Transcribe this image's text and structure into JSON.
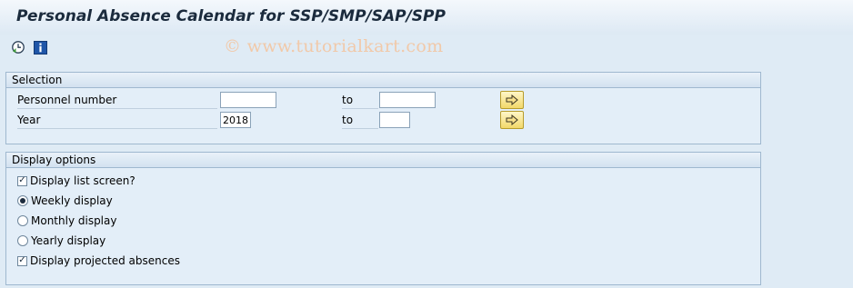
{
  "window": {
    "title": "Personal Absence Calendar for SSP/SMP/SAP/SPP"
  },
  "toolbar": {
    "buttons": [
      {
        "icon": "execute-clock-icon",
        "interactable": true
      },
      {
        "icon": "info-icon",
        "interactable": true
      }
    ]
  },
  "watermark": "© www.tutorialkart.com",
  "selection": {
    "header": "Selection",
    "rows": [
      {
        "label": "Personnel number",
        "from_value": "",
        "to_label": "to",
        "to_value": ""
      },
      {
        "label": "Year",
        "from_value": "2018",
        "to_label": "to",
        "to_value": ""
      }
    ]
  },
  "display_options": {
    "header": "Display options",
    "items": [
      {
        "type": "checkbox",
        "label": "Display list screen?",
        "checked": true
      },
      {
        "type": "radio",
        "label": "Weekly display",
        "checked": true
      },
      {
        "type": "radio",
        "label": "Monthly display",
        "checked": false
      },
      {
        "type": "radio",
        "label": "Yearly display",
        "checked": false
      },
      {
        "type": "checkbox",
        "label": "Display projected absences",
        "checked": true
      }
    ]
  },
  "colors": {
    "background": "#dfebf5",
    "group_border": "#9fb8cf",
    "multiple_selection_button": "#f2d86a",
    "watermark": "#f1c9a9"
  }
}
